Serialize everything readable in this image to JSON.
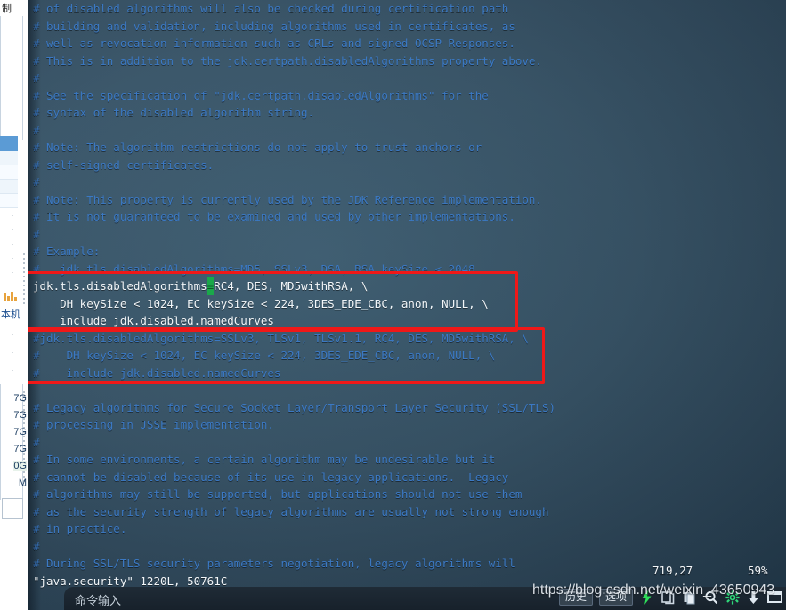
{
  "background_app": {
    "top_label": "制",
    "cn_label": "本机",
    "sizes": [
      "7G",
      "7G",
      "7G",
      "7G",
      "0G",
      "M"
    ]
  },
  "terminal": {
    "lines": [
      {
        "text": "# of disabled algorithms will also be checked during certification path",
        "style": "comment"
      },
      {
        "text": "# building and validation, including algorithms used in certificates, as",
        "style": "comment"
      },
      {
        "text": "# well as revocation information such as CRLs and signed OCSP Responses.",
        "style": "comment"
      },
      {
        "text": "# This is in addition to the jdk.certpath.disabledAlgorithms property above.",
        "style": "comment"
      },
      {
        "text": "#",
        "style": "comment"
      },
      {
        "text": "# See the specification of \"jdk.certpath.disabledAlgorithms\" for the",
        "style": "comment"
      },
      {
        "text": "# syntax of the disabled algorithm string.",
        "style": "comment"
      },
      {
        "text": "#",
        "style": "comment"
      },
      {
        "text": "# Note: The algorithm restrictions do not apply to trust anchors or",
        "style": "comment"
      },
      {
        "text": "# self-signed certificates.",
        "style": "comment"
      },
      {
        "text": "#",
        "style": "comment"
      },
      {
        "text": "# Note: This property is currently used by the JDK Reference implementation.",
        "style": "comment"
      },
      {
        "text": "# It is not guaranteed to be examined and used by other implementations.",
        "style": "comment"
      },
      {
        "text": "#",
        "style": "comment"
      },
      {
        "text": "# Example:",
        "style": "comment"
      },
      {
        "text": "#   jdk.tls.disabledAlgorithms=MD5, SSLv3, DSA, RSA keySize < 2048",
        "style": "comment"
      },
      {
        "text": "jdk.tls.disabledAlgorithms=RC4, DES, MD5withRSA, \\",
        "style": "active",
        "cursor_col": 26
      },
      {
        "text": "    DH keySize < 1024, EC keySize < 224, 3DES_EDE_CBC, anon, NULL, \\",
        "style": "active"
      },
      {
        "text": "    include jdk.disabled.namedCurves",
        "style": "active"
      },
      {
        "text": "#jdk.tls.disabledAlgorithms=SSLv3, TLSv1, TLSv1.1, RC4, DES, MD5withRSA, \\",
        "style": "comment"
      },
      {
        "text": "#    DH keySize < 1024, EC keySize < 224, 3DES_EDE_CBC, anon, NULL, \\",
        "style": "comment"
      },
      {
        "text": "#    include jdk.disabled.namedCurves",
        "style": "comment"
      },
      {
        "text": "",
        "style": "comment"
      },
      {
        "text": "# Legacy algorithms for Secure Socket Layer/Transport Layer Security (SSL/TLS)",
        "style": "comment"
      },
      {
        "text": "# processing in JSSE implementation.",
        "style": "comment"
      },
      {
        "text": "#",
        "style": "comment"
      },
      {
        "text": "# In some environments, a certain algorithm may be undesirable but it",
        "style": "comment"
      },
      {
        "text": "# cannot be disabled because of its use in legacy applications.  Legacy",
        "style": "comment"
      },
      {
        "text": "# algorithms may still be supported, but applications should not use them",
        "style": "comment"
      },
      {
        "text": "# as the security strength of legacy algorithms are usually not strong enough",
        "style": "comment"
      },
      {
        "text": "# in practice.",
        "style": "comment"
      },
      {
        "text": "#",
        "style": "comment"
      },
      {
        "text": "# During SSL/TLS security parameters negotiation, legacy algorithms will",
        "style": "comment"
      },
      {
        "text": "\"java.security\" 1220L, 50761C",
        "style": "status"
      }
    ],
    "position": "719,27",
    "percent": "59%",
    "colors": {
      "comment_text": "#3b79c4",
      "active_text": "#f2f6f9",
      "cursor": "#1aa84a",
      "annotation": "#f01818",
      "background": "#375468"
    }
  },
  "annotations": [
    {
      "name": "active-config-highlight"
    },
    {
      "name": "commented-config-highlight"
    }
  ],
  "command_bar": {
    "input_placeholder": "命令输入",
    "buttons": [
      {
        "label": "历史",
        "name": "history-button"
      },
      {
        "label": "选项",
        "name": "options-button"
      }
    ],
    "icons": [
      "lightning-icon",
      "copy-icon",
      "paste-icon",
      "search-icon",
      "gear-icon",
      "download-icon",
      "window-icon"
    ]
  },
  "watermark": {
    "url": "https://blog.csdn.net/weixin_43650943"
  }
}
